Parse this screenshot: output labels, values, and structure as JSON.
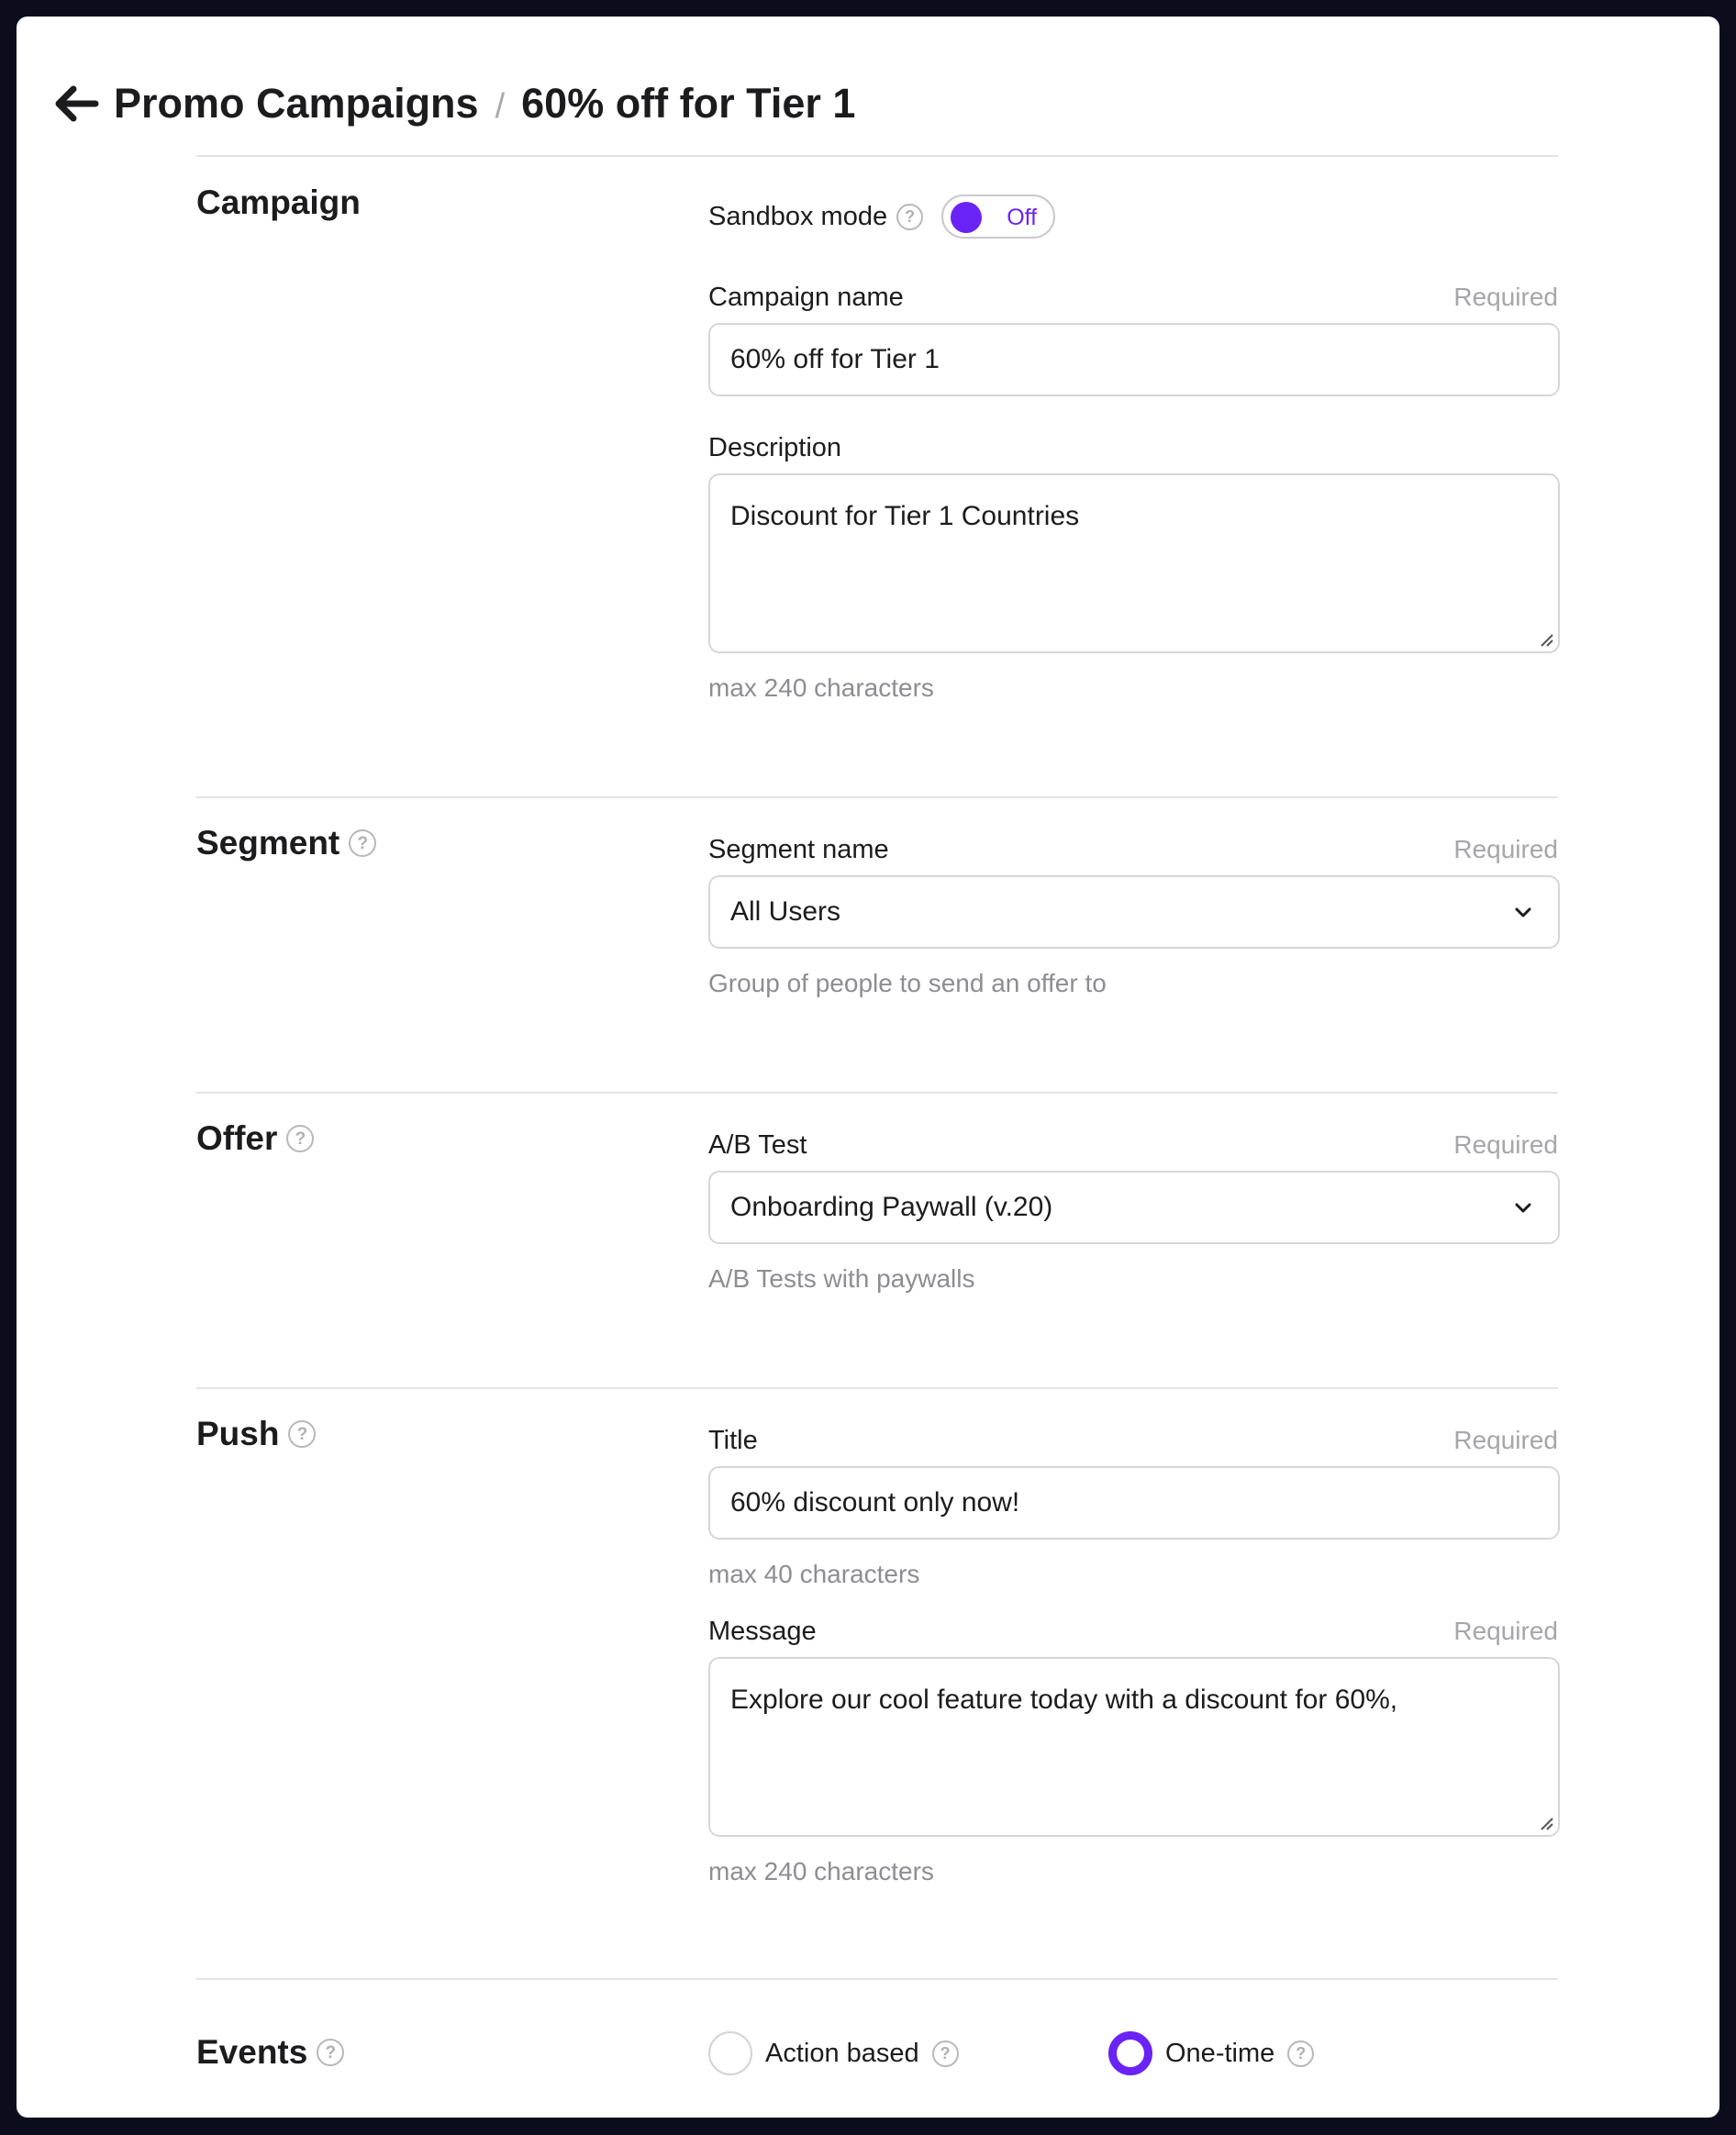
{
  "breadcrumb": {
    "root": "Promo Campaigns",
    "separator": "/",
    "current": "60% off for Tier 1"
  },
  "campaign": {
    "title": "Campaign",
    "sandbox_label": "Sandbox mode",
    "sandbox_state": "Off",
    "name_label": "Campaign name",
    "name_required": "Required",
    "name_value": "60% off for Tier 1",
    "description_label": "Description",
    "description_value": "Discount for Tier 1 Countries",
    "description_hint": "max 240 characters"
  },
  "segment": {
    "title": "Segment",
    "name_label": "Segment name",
    "name_required": "Required",
    "selected": "All Users",
    "hint": "Group of people to send an offer to"
  },
  "offer": {
    "title": "Offer",
    "ab_label": "A/B Test",
    "ab_required": "Required",
    "selected": "Onboarding Paywall (v.20)",
    "hint": "A/B Tests with paywalls"
  },
  "push": {
    "title": "Push",
    "title_label": "Title",
    "title_required": "Required",
    "title_value": "60% discount only now!",
    "title_hint": "max 40 characters",
    "message_label": "Message",
    "message_required": "Required",
    "message_value": "Explore our cool feature today with a discount for 60%,",
    "message_hint": "max 240 characters"
  },
  "events": {
    "title": "Events",
    "option_action": "Action based",
    "option_onetime": "One-time",
    "selected": "One-time"
  },
  "colors": {
    "accent": "#6a23f5",
    "border": "#d6d6da",
    "muted": "#8d8d92"
  },
  "icons": {
    "back": "arrow-left-icon",
    "help": "question-circle-icon",
    "dropdown": "chevron-down-icon",
    "resize": "resize-handle-icon"
  }
}
